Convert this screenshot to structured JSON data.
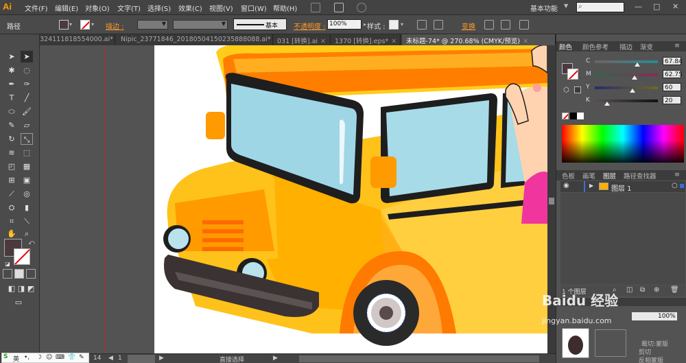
{
  "app": {
    "logo": "Ai",
    "workspace": "基本功能"
  },
  "menu": {
    "items": [
      "文件(F)",
      "编辑(E)",
      "对象(O)",
      "文字(T)",
      "选择(S)",
      "效果(C)",
      "视图(V)",
      "窗口(W)",
      "帮助(H)"
    ]
  },
  "window_controls": {
    "minimize": "—",
    "maximize": "□",
    "close": "✕"
  },
  "control": {
    "selection_label": "路径",
    "stroke_label": "描边 :",
    "stroke_profile": "基本",
    "opacity_label": "不透明度 :",
    "opacity_value": "100%",
    "style_label": "样式 :",
    "transform_label": "变换"
  },
  "tabs": [
    {
      "label": "324111818554000.ai*",
      "close": "✕"
    },
    {
      "label": "Nipic_23771846_20180504150235888088.ai*",
      "close": "✕"
    },
    {
      "label": "031 [转换].ai",
      "close": "✕"
    },
    {
      "label": "1370 [转换].eps*",
      "close": "✕"
    },
    {
      "label": "未标题-74* @ 270.68% (CMYK/预览)",
      "close": "✕"
    }
  ],
  "color_panel": {
    "tabs": [
      "颜色",
      "颜色参考",
      "描边",
      "渐变"
    ],
    "sliders": [
      {
        "label": "C",
        "value": "67.84",
        "fraction": 0.6784
      },
      {
        "label": "M",
        "value": "62.75",
        "fraction": 0.6275
      },
      {
        "label": "Y",
        "value": "60",
        "fraction": 0.6
      },
      {
        "label": "K",
        "value": "20",
        "fraction": 0.2
      }
    ]
  },
  "layers_panel": {
    "tabs": [
      "色板",
      "画笔",
      "图层",
      "路径查找器"
    ],
    "layer_name": "图层 1",
    "count_label": "1 个图层"
  },
  "nav_panel": {
    "zoom": "100%",
    "opt1": "剪切",
    "opt2": "反相蒙版",
    "opt3": "裁切:蒙版"
  },
  "status": {
    "zoom_page": "14",
    "page": "1",
    "tool_name": "直接选择"
  },
  "ime": {
    "lang": "英"
  },
  "watermark": {
    "text": "Baidu 经验",
    "url": "jingyan.baidu.com"
  },
  "colors": {
    "fill": "#4a3a3e",
    "accent_orange": "#ff9a2e",
    "bus_yellow": "#ffc21a",
    "bus_orange": "#ff7a00",
    "window_blue": "#9fd6e6"
  }
}
